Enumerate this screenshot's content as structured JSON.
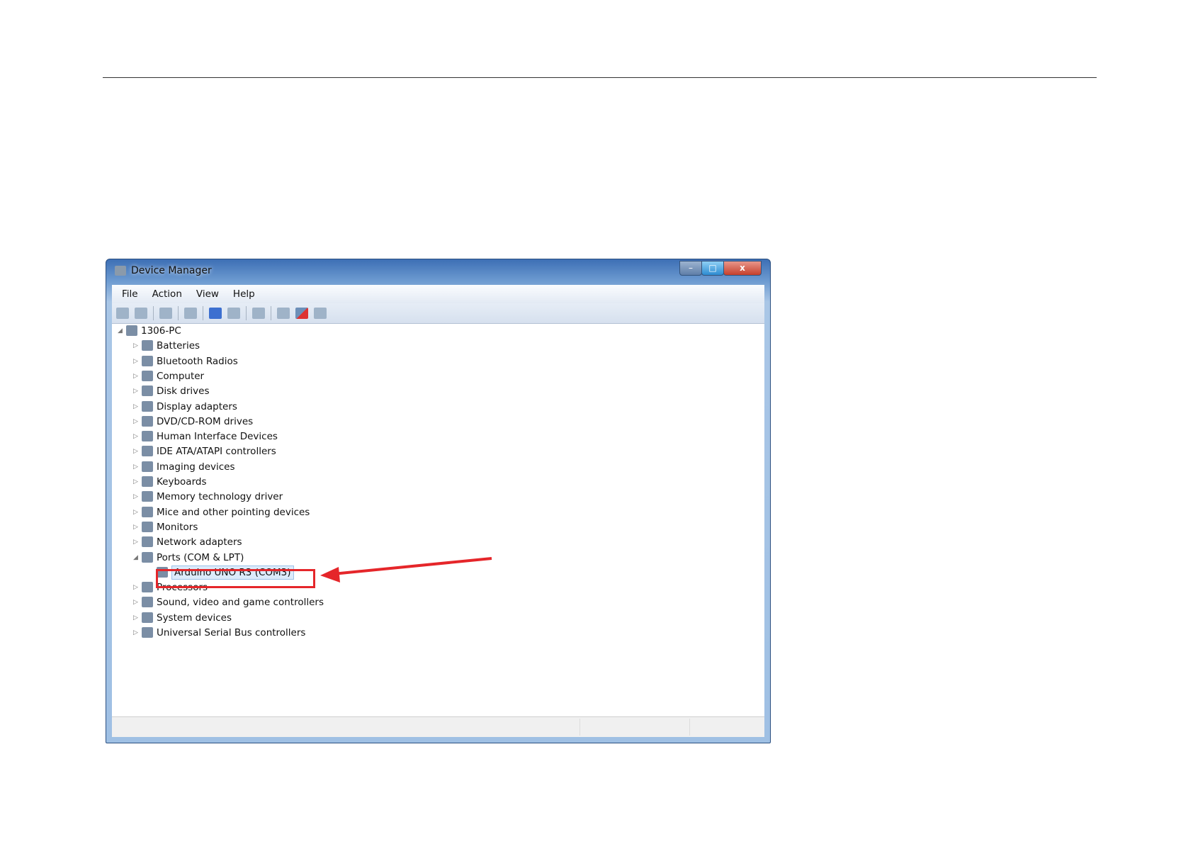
{
  "window": {
    "title": "Device Manager",
    "min": "–",
    "max": "□",
    "close": "x"
  },
  "menu": [
    "File",
    "Action",
    "View",
    "Help"
  ],
  "toolbar_icons": [
    "back-icon",
    "forward-icon",
    "show-hide-tree-icon",
    "properties-icon",
    "help-icon",
    "view-icon",
    "scan-hardware-icon",
    "update-driver-icon",
    "uninstall-icon",
    "disable-icon"
  ],
  "tree": {
    "root": "1306-PC",
    "items": [
      "Batteries",
      "Bluetooth Radios",
      "Computer",
      "Disk drives",
      "Display adapters",
      "DVD/CD-ROM drives",
      "Human Interface Devices",
      "IDE ATA/ATAPI controllers",
      "Imaging devices",
      "Keyboards",
      "Memory technology driver",
      "Mice and other pointing devices",
      "Monitors",
      "Network adapters",
      "Ports (COM & LPT)"
    ],
    "selected_child": "Arduino UNO R3 (COM3)",
    "after": [
      "Processors",
      "Sound, video and game controllers",
      "System devices",
      "Universal Serial Bus controllers"
    ]
  },
  "annotation_color": "#e5262a"
}
